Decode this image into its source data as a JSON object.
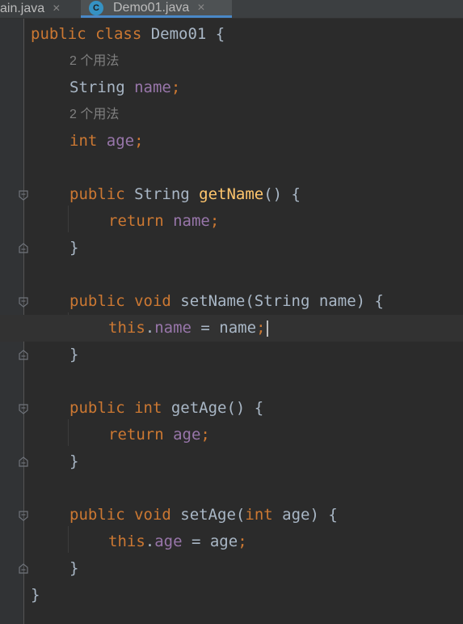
{
  "tabs": [
    {
      "label": "ain.java",
      "close": "×"
    },
    {
      "label": "Demo01.java",
      "close": "×",
      "icon": "C"
    }
  ],
  "hints": {
    "usage1": "2 个用法",
    "usage2": "2 个用法"
  },
  "code": {
    "l1": {
      "a": "public class ",
      "b": "Demo01",
      "c": " {"
    },
    "l3": {
      "a": "String ",
      "b": "name",
      "c": ";"
    },
    "l5": {
      "a": "int ",
      "b": "age",
      "c": ";"
    },
    "l7": {
      "a": "public ",
      "b": "String ",
      "c": "getName",
      "d": "() {"
    },
    "l8": {
      "a": "return ",
      "b": "name",
      "c": ";"
    },
    "l9": "}",
    "l11": {
      "a": "public void ",
      "b": "setName",
      "c": "(String name) {"
    },
    "l12": {
      "a": "this",
      "b": ".",
      "c": "name",
      "d": " = name",
      "e": ";"
    },
    "l13": "}",
    "l15": {
      "a": "public int ",
      "b": "getAge",
      "c": "() {"
    },
    "l16": {
      "a": "return ",
      "b": "age",
      "c": ";"
    },
    "l17": "}",
    "l19": {
      "a": "public void ",
      "b": "setAge",
      "c": "(",
      "d": "int ",
      "e": "age) {"
    },
    "l20": {
      "a": "this",
      "b": ".",
      "c": "age",
      "d": " = age",
      "e": ";"
    },
    "l21": "}",
    "l22": "}"
  },
  "colors": {
    "keyword": "#cc7832",
    "field": "#9876aa",
    "method": "#ffc66d",
    "text": "#a9b7c6",
    "background": "#2b2b2b"
  }
}
